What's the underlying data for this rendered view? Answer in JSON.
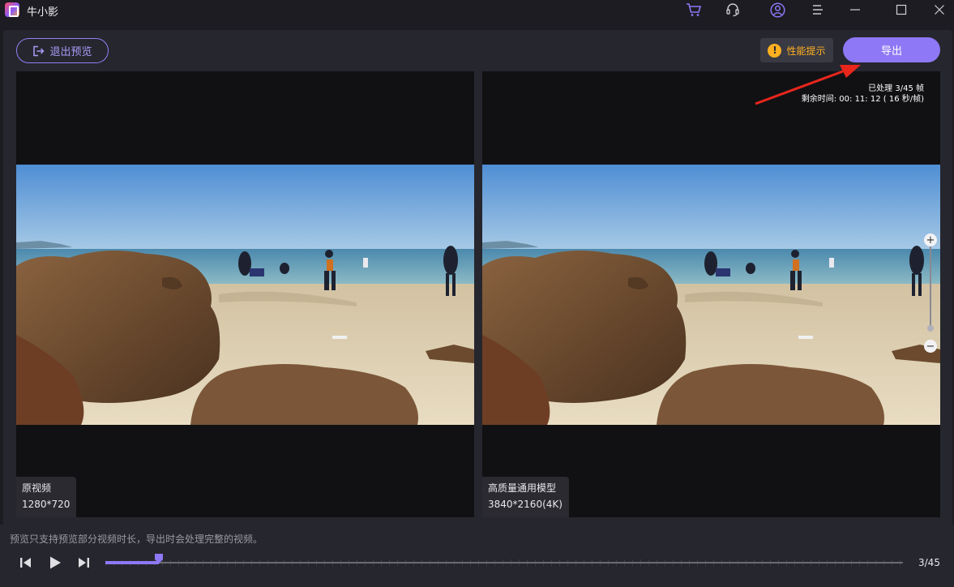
{
  "app": {
    "title": "牛小影"
  },
  "titlebar": {
    "icons": [
      "cart-icon",
      "headset-icon",
      "user-icon",
      "menu-icon",
      "minimize-icon",
      "maximize-icon",
      "close-icon"
    ]
  },
  "toolbar": {
    "exit_label": "退出预览",
    "perf_label": "性能提示",
    "perf_badge": "!",
    "export_label": "导出"
  },
  "panes": {
    "original": {
      "name": "原视频",
      "resolution": "1280*720"
    },
    "enhanced": {
      "name": "高质量通用模型",
      "resolution": "3840*2160(4K)"
    }
  },
  "progress": {
    "processed": "已处理 3/45 帧",
    "remaining": "剩余时间: 00: 11: 12 ( 16 秒/帧)"
  },
  "zoom": {
    "in": "+",
    "out": "−",
    "level": 0
  },
  "footer": {
    "hint": "预览只支持预览部分视频时长，导出时会处理完整的视频。",
    "frame_counter": "3/45",
    "current_frame": 3,
    "total_frames": 45
  },
  "colors": {
    "accent": "#8e78f5",
    "warning": "#ffb020",
    "annotation_arrow": "#e8261b"
  }
}
